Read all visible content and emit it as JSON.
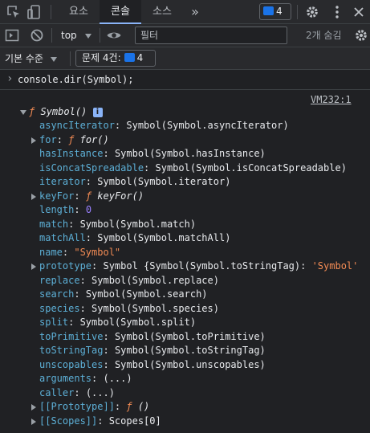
{
  "tabs": {
    "items": [
      {
        "label": "요소"
      },
      {
        "label": "콘솔"
      },
      {
        "label": "소스"
      }
    ],
    "more_label": "»",
    "issues_badge_count": "4"
  },
  "toolbar": {
    "context_label": "top",
    "filter_placeholder": "필터",
    "hidden_count_label": "2개 숨김"
  },
  "issuesbar": {
    "level_label": "기본 수준",
    "issues_label": "문제 4건:",
    "issues_count": "4"
  },
  "console": {
    "prompt_symbol": "›",
    "command": "console.dir(Symbol);",
    "source_link": "VM232:1",
    "root": {
      "f_glyph": "ƒ",
      "label": "Symbol()",
      "info": "i"
    },
    "props": [
      {
        "key": "asyncIterator",
        "value": "Symbol(Symbol.asyncIterator)",
        "vclass": "plain",
        "expandable": false
      },
      {
        "key": "for",
        "value": "ƒ for()",
        "vclass": "fn",
        "expandable": true
      },
      {
        "key": "hasInstance",
        "value": "Symbol(Symbol.hasInstance)",
        "vclass": "plain",
        "expandable": false
      },
      {
        "key": "isConcatSpreadable",
        "value": "Symbol(Symbol.isConcatSpreadable)",
        "vclass": "plain",
        "expandable": false
      },
      {
        "key": "iterator",
        "value": "Symbol(Symbol.iterator)",
        "vclass": "plain",
        "expandable": false
      },
      {
        "key": "keyFor",
        "value": "ƒ keyFor()",
        "vclass": "fn",
        "expandable": true
      },
      {
        "key": "length",
        "value": "0",
        "vclass": "num",
        "expandable": false
      },
      {
        "key": "match",
        "value": "Symbol(Symbol.match)",
        "vclass": "plain",
        "expandable": false
      },
      {
        "key": "matchAll",
        "value": "Symbol(Symbol.matchAll)",
        "vclass": "plain",
        "expandable": false
      },
      {
        "key": "name",
        "value": "\"Symbol\"",
        "vclass": "str",
        "expandable": false
      },
      {
        "key": "prototype",
        "value": "Symbol {Symbol(Symbol.toStringTag): 'Symbol'",
        "vclass": "proto",
        "expandable": true
      },
      {
        "key": "replace",
        "value": "Symbol(Symbol.replace)",
        "vclass": "plain",
        "expandable": false
      },
      {
        "key": "search",
        "value": "Symbol(Symbol.search)",
        "vclass": "plain",
        "expandable": false
      },
      {
        "key": "species",
        "value": "Symbol(Symbol.species)",
        "vclass": "plain",
        "expandable": false
      },
      {
        "key": "split",
        "value": "Symbol(Symbol.split)",
        "vclass": "plain",
        "expandable": false
      },
      {
        "key": "toPrimitive",
        "value": "Symbol(Symbol.toPrimitive)",
        "vclass": "plain",
        "expandable": false
      },
      {
        "key": "toStringTag",
        "value": "Symbol(Symbol.toStringTag)",
        "vclass": "plain",
        "expandable": false
      },
      {
        "key": "unscopables",
        "value": "Symbol(Symbol.unscopables)",
        "vclass": "plain",
        "expandable": false
      },
      {
        "key": "arguments",
        "value": "(...)",
        "vclass": "plain",
        "expandable": false
      },
      {
        "key": "caller",
        "value": "(...)",
        "vclass": "plain",
        "expandable": false
      },
      {
        "key": "[[Prototype]]",
        "value": "ƒ ()",
        "vclass": "fn",
        "expandable": true
      },
      {
        "key": "[[Scopes]]",
        "value": "Scopes[0]",
        "vclass": "plain",
        "expandable": true
      }
    ]
  },
  "colors": {
    "background": "#202124",
    "toolbar": "#292a2d",
    "key": "#5db0d7",
    "string": "#f28b54",
    "number": "#9980ff",
    "link": "#8ab4f8",
    "badge": "#1a73e8"
  },
  "icons": {
    "inspect": "inspect-element-icon",
    "device": "device-toolbar-icon",
    "settings": "gear-icon",
    "more": "kebab-menu-icon",
    "sidebar": "sidebar-toggle-icon",
    "clear": "clear-console-icon",
    "eye": "eye-icon",
    "console_settings": "gear-icon"
  }
}
